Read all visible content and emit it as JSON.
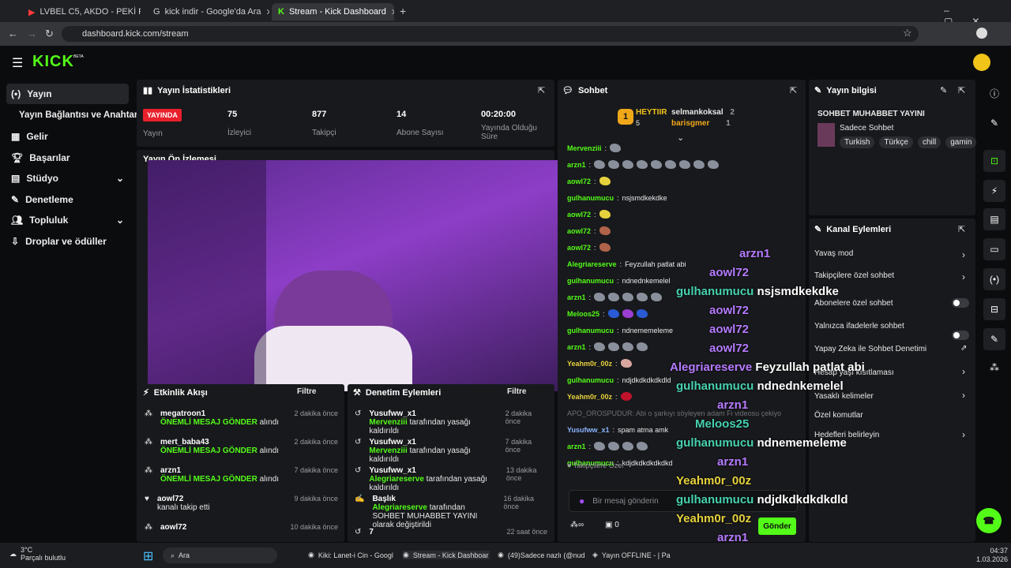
{
  "browser": {
    "tabs": [
      {
        "title": "LVBEL C5, AKDO - PEKİ PEKİ"
      },
      {
        "title": "kick indir - Google'da Ara"
      },
      {
        "title": "Stream - Kick Dashboard"
      }
    ],
    "url": "dashboard.kick.com/stream"
  },
  "nav": {
    "logo": "KICK",
    "beta": "BETA"
  },
  "sidebar": {
    "items": [
      {
        "label": "Yayın"
      },
      {
        "label": "Yayın Bağlantısı ve Anahtarı"
      },
      {
        "label": "Gelir"
      },
      {
        "label": "Başarılar"
      },
      {
        "label": "Stüdyo"
      },
      {
        "label": "Denetleme"
      },
      {
        "label": "Topluluk"
      },
      {
        "label": "Droplar ve ödüller"
      }
    ]
  },
  "stats": {
    "title": "Yayın İstatistikleri",
    "live_badge": "YAYINDA",
    "live_label": "Yayın",
    "viewers": "75",
    "viewers_label": "İzleyici",
    "followers": "877",
    "followers_label": "Takipçi",
    "subs": "14",
    "subs_label": "Abone Sayısı",
    "duration": "00:20:00",
    "duration_label": "Yayında Olduğu Süre",
    "preview_title": "Yayın Ön İzlemesi"
  },
  "activity": {
    "title": "Etkinlik Akışı",
    "filter": "Filtre",
    "rows": [
      {
        "name": "megatroon1",
        "action": "ÖNEMLİ MESAJ GÖNDER",
        "suffix": "alındı",
        "time": "2 dakika önce"
      },
      {
        "name": "mert_baba43",
        "action": "ÖNEMLİ MESAJ GÖNDER",
        "suffix": "alındı",
        "time": "2 dakika önce"
      },
      {
        "name": "arzn1",
        "action": "ÖNEMLİ MESAJ GÖNDER",
        "suffix": "alındı",
        "time": "7 dakika önce"
      },
      {
        "name": "aowl72",
        "action": "",
        "suffix": "kanalı takip etti",
        "time": "9 dakika önce"
      },
      {
        "name": "aowl72",
        "action": "",
        "suffix": "",
        "time": "10 dakika önce"
      }
    ]
  },
  "moderation": {
    "title": "Denetim Eylemleri",
    "filter": "Filtre",
    "rows": [
      {
        "name": "Yusufww_x1",
        "by": "Mervenziii",
        "suffix": "tarafından yasağı kaldırıldı",
        "time": "2 dakika önce"
      },
      {
        "name": "Yusufww_x1",
        "by": "Mervenziii",
        "suffix": "tarafından yasağı kaldırıldı",
        "time": "7 dakika önce"
      },
      {
        "name": "Yusufww_x1",
        "by": "Alegriareserve",
        "suffix": "tarafından yasağı kaldırıldı",
        "time": "13 dakika önce"
      },
      {
        "name": "Başlık",
        "by": "Alegriareserve",
        "suffix": "tarafından SOHBET MUHABBET YAYINI olarak değiştirildi",
        "time": "16 dakika önce"
      },
      {
        "name": "7",
        "by": "",
        "suffix": "",
        "time": "22 saat önce"
      }
    ]
  },
  "chat": {
    "title": "Sohbet",
    "top_name": "HEYTIIR",
    "top_rank": "1",
    "top_count": "5",
    "g1": "selmankoksal",
    "g1n": "2",
    "g2": "barisgmer",
    "g2n": "1",
    "lines": [
      {
        "u": "Mervenziii",
        "t": ""
      },
      {
        "u": "arzn1",
        "t": ""
      },
      {
        "u": "aowl72",
        "t": ""
      },
      {
        "u": "gulhanumucu",
        "t": "nsjsmdkekdke"
      },
      {
        "u": "aowl72",
        "t": ""
      },
      {
        "u": "aowl72",
        "t": ""
      },
      {
        "u": "aowl72",
        "t": ""
      },
      {
        "u": "Alegriareserve",
        "t": "Feyzullah patlat abi"
      },
      {
        "u": "gulhanumucu",
        "t": "ndnednkemelel"
      },
      {
        "u": "arzn1",
        "t": ""
      },
      {
        "u": "Meloos25",
        "t": ""
      },
      {
        "u": "gulhanumucu",
        "t": "ndnememeleme"
      },
      {
        "u": "arzn1",
        "t": ""
      },
      {
        "u": "Yeahm0r_00z",
        "t": ""
      },
      {
        "u": "gulhanumucu",
        "t": "ndjdkdkdkdkdld"
      },
      {
        "u": "Yeahm0r_00z",
        "t": ""
      }
    ],
    "system": "APO_OROSPUDUR: Abi o şarkıyı söyleyen adam Fi videosu çekiyo",
    "line2": {
      "u": "Yusufww_x1",
      "t": "spam atma amk"
    },
    "line3": {
      "u": "arzn1",
      "t": ""
    },
    "line4": {
      "u": "gulhanumucu",
      "t": "kdjdkdkdkdkdkd"
    },
    "followers_only": "Takipçilere Özel",
    "placeholder": "Bir mesaj gönderin",
    "count": "0",
    "send": "Gönder"
  },
  "info": {
    "title": "Yayın bilgisi",
    "stream_title": "SOHBET MUHABBET YAYINI",
    "category": "Sadece Sohbet",
    "tags": [
      "Turkish",
      "Türkçe",
      "chill",
      "gamin"
    ]
  },
  "channel": {
    "title": "Kanal Eylemleri",
    "rows": [
      {
        "label": "Yavaş mod"
      },
      {
        "label": "Takipçilere özel sohbet"
      },
      {
        "label": "Abonelere özel sohbet"
      },
      {
        "label": "Yalnızca ifadelerle sohbet"
      },
      {
        "label": "Yapay Zeka ile Sohbet Denetimi"
      },
      {
        "label": "Hesap yaşı kısıtlaması"
      },
      {
        "label": "Yasaklı kelimeler"
      },
      {
        "label": "Özel komutlar"
      },
      {
        "label": "Hedefleri belirleyin"
      }
    ]
  },
  "overlay": [
    {
      "u": "arzn1",
      "t": "",
      "c": "#b57bff"
    },
    {
      "u": "aowl72",
      "t": "",
      "c": "#b57bff"
    },
    {
      "u": "gulhanumucu",
      "t": "nsjsmdkekdke",
      "c": "#46d1b0"
    },
    {
      "u": "aowl72",
      "t": "",
      "c": "#b57bff"
    },
    {
      "u": "aowl72",
      "t": "",
      "c": "#b57bff"
    },
    {
      "u": "aowl72",
      "t": "",
      "c": "#b57bff"
    },
    {
      "u": "Alegriareserve",
      "t": "Feyzullah patlat abi",
      "c": "#b57bff"
    },
    {
      "u": "gulhanumucu",
      "t": "ndnednkemelel",
      "c": "#46d1b0"
    },
    {
      "u": "arzn1",
      "t": "",
      "c": "#b57bff"
    },
    {
      "u": "Meloos25",
      "t": "",
      "c": "#46d1b0"
    },
    {
      "u": "gulhanumucu",
      "t": "ndnememeleme",
      "c": "#46d1b0"
    },
    {
      "u": "arzn1",
      "t": "",
      "c": "#b57bff"
    },
    {
      "u": "Yeahm0r_00z",
      "t": "",
      "c": "#e6d13c"
    },
    {
      "u": "gulhanumucu",
      "t": "ndjdkdkdkdkdld",
      "c": "#46d1b0"
    },
    {
      "u": "Yeahm0r_00z",
      "t": "",
      "c": "#e6d13c"
    },
    {
      "u": "arzn1",
      "t": "",
      "c": "#b57bff"
    },
    {
      "u": "gulhanumucu",
      "t": "kdjdkdkdkdkdkd",
      "c": "#46d1b0"
    }
  ],
  "taskbar": {
    "weather": "3°C",
    "weather_desc": "Parçalı bulutlu",
    "search": "Ara",
    "apps": [
      "Kiki: Lanet-i Cin - Googl",
      "Stream - Kick Dashboar",
      "(49)Sadece nazlı (@nud",
      "Yayın OFFLINE - | Pa"
    ],
    "time": "04:37",
    "date": "1.03.2026"
  },
  "colors": {
    "brand": "#53fc18",
    "live": "#e8202c"
  }
}
